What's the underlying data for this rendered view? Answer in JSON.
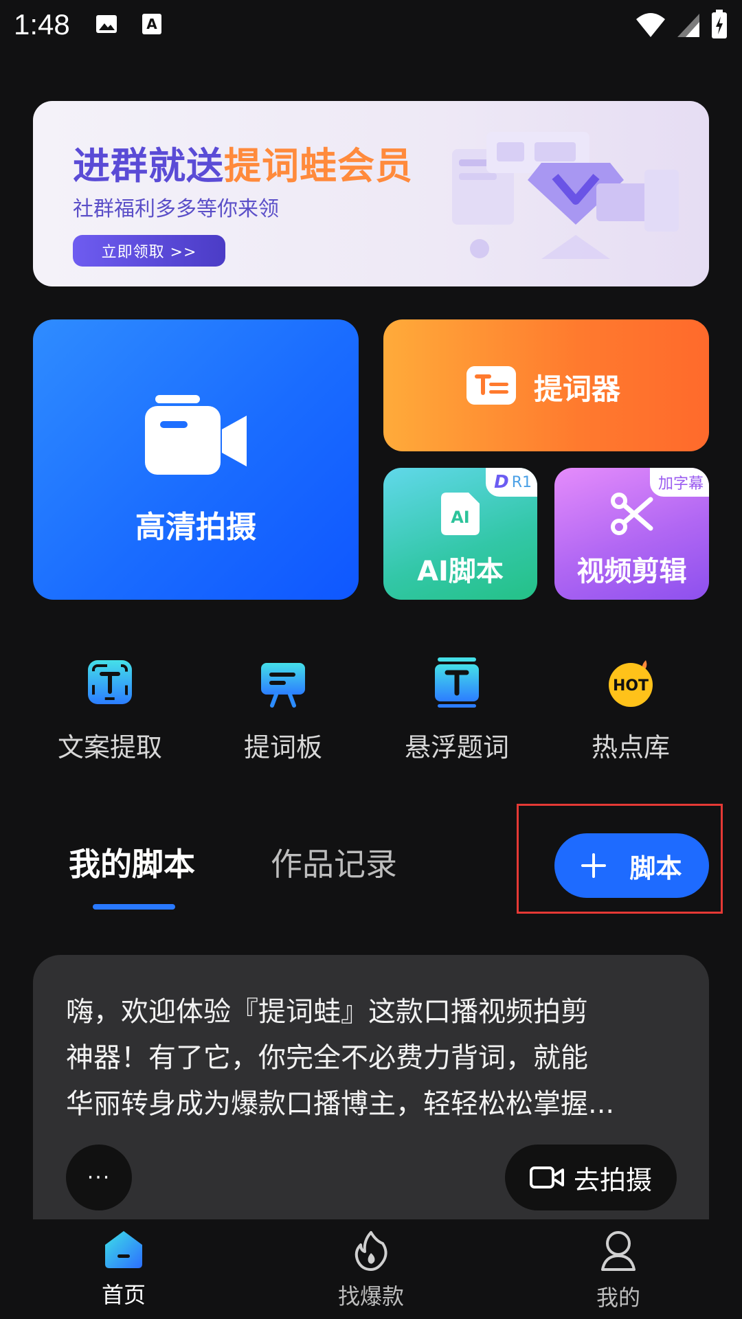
{
  "status_bar": {
    "time": "1:48",
    "left_icons": [
      "image-icon",
      "accessibility-a-icon"
    ],
    "right_icons": [
      "wifi-icon",
      "signal-icon",
      "battery-charging-icon"
    ]
  },
  "banner": {
    "title_part1": "进群就送",
    "title_part2": "提词蛙会员",
    "subtitle": "社群福利多多等你来领",
    "button": "立即领取 >>"
  },
  "features": {
    "camera": {
      "label": "高清拍摄",
      "icon": "video-camera-icon"
    },
    "teleprompter": {
      "label": "提词器",
      "icon": "teleprompter-icon"
    },
    "ai_script": {
      "label": "AI脚本",
      "badge": "R1",
      "icon_text": "AI"
    },
    "video_edit": {
      "label": "视频剪辑",
      "badge": "加字幕",
      "icon": "scissors-icon"
    }
  },
  "tools": [
    {
      "label": "文案提取",
      "icon": "text-extract-icon"
    },
    {
      "label": "提词板",
      "icon": "prompt-board-icon"
    },
    {
      "label": "悬浮题词",
      "icon": "floating-prompt-icon"
    },
    {
      "label": "热点库",
      "icon": "hot-icon",
      "icon_text": "HOT"
    }
  ],
  "tabs": {
    "active": "我的脚本",
    "inactive": "作品记录"
  },
  "add_script_button": {
    "label": "脚本"
  },
  "script_card": {
    "lines": [
      "嗨，欢迎体验『提词蛙』这款口播视频拍剪",
      "神器！有了它，你完全不必费力背词，就能",
      "华丽转身成为爆款口播博主，轻轻松松掌握..."
    ],
    "more_label": "···",
    "shoot_label": "去拍摄"
  },
  "bottom_nav": [
    {
      "label": "首页",
      "icon": "home-icon",
      "active": true
    },
    {
      "label": "找爆款",
      "icon": "fire-icon",
      "active": false
    },
    {
      "label": "我的",
      "icon": "profile-icon",
      "active": false
    }
  ],
  "colors": {
    "background": "#111112",
    "primary_blue": "#1e6bff",
    "orange": "#ff7a2e",
    "highlight_red": "#e53935"
  }
}
